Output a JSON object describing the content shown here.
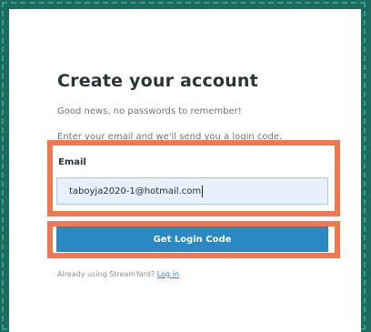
{
  "form": {
    "title": "Create your account",
    "subtitle": "Good news, no passwords to remember!",
    "instructions": "Enter your email and we'll send you a login code.",
    "email_label": "Email",
    "email_value": "taboyja2020-1@hotmail.com",
    "submit_label": "Get Login Code",
    "already_text": "Already using StreamYard?",
    "login_link": "Log in",
    "period": "."
  },
  "colors": {
    "background": "#1d6b5e",
    "highlight": "#f07850",
    "button": "#2a89c2"
  }
}
